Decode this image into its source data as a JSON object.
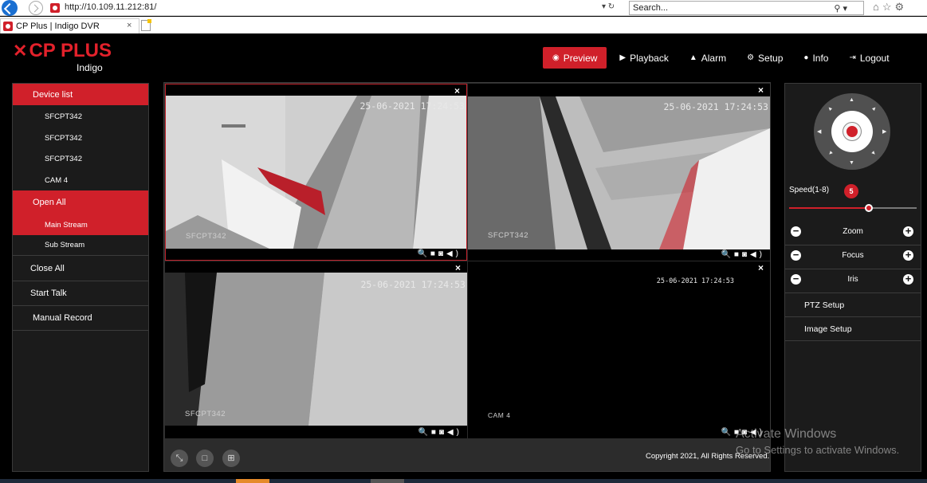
{
  "browser": {
    "url": "http://10.109.11.212:81/",
    "search_placeholder": "Search...",
    "tab_title": "CP Plus | Indigo DVR",
    "tab_close": "×",
    "refresh_glyphs": "▾ ↻"
  },
  "brand": {
    "logo_text": "CP PLUS",
    "logo_sub": "Indigo",
    "accent": "#d0202a"
  },
  "topnav": [
    {
      "label": "Preview",
      "icon": "eye-icon",
      "glyph": "◉",
      "active": true
    },
    {
      "label": "Playback",
      "icon": "play-icon",
      "glyph": "▶",
      "active": false
    },
    {
      "label": "Alarm",
      "icon": "bell-icon",
      "glyph": "🔔",
      "active": false
    },
    {
      "label": "Setup",
      "icon": "gear-icon",
      "glyph": "⚙",
      "active": false
    },
    {
      "label": "Info",
      "icon": "info-icon",
      "glyph": "ℹ",
      "active": false
    },
    {
      "label": "Logout",
      "icon": "logout-icon",
      "glyph": "⇥",
      "active": false
    }
  ],
  "sidebar": {
    "device_list": "Device list",
    "devices": [
      "SFCPT342",
      "SFCPT342",
      "SFCPT342",
      "CAM 4"
    ],
    "open_all": "Open All",
    "main_stream": "Main Stream",
    "sub_stream": "Sub Stream",
    "close_all": "Close All",
    "start_talk": "Start Talk",
    "manual_record": "Manual Record"
  },
  "panes": [
    {
      "timestamp": "25-06-2021 17:24:53",
      "camera": "SFCPT342"
    },
    {
      "timestamp": "25-06-2021 17:24:53",
      "camera": "SFCPT342"
    },
    {
      "timestamp": "25-06-2021 17:24:53",
      "camera": "SFCPT342"
    },
    {
      "timestamp": "25-06-2021 17:24:53",
      "camera": "CAM 4"
    }
  ],
  "pane_close": "×",
  "pane_tools": "🔍■◙◀)",
  "grid_footer": {
    "copyright": "Copyright 2021, All Rights Reserved."
  },
  "ptz": {
    "speed_label": "Speed(1-8)",
    "speed_value": "5",
    "speed_level": 5,
    "speed_max": 8,
    "zoom": "Zoom",
    "focus": "Focus",
    "iris": "Iris",
    "ptz_setup": "PTZ Setup",
    "image_setup": "Image Setup"
  },
  "watermark": {
    "line1": "Activate Windows",
    "line2": "Go to Settings to activate Windows."
  }
}
